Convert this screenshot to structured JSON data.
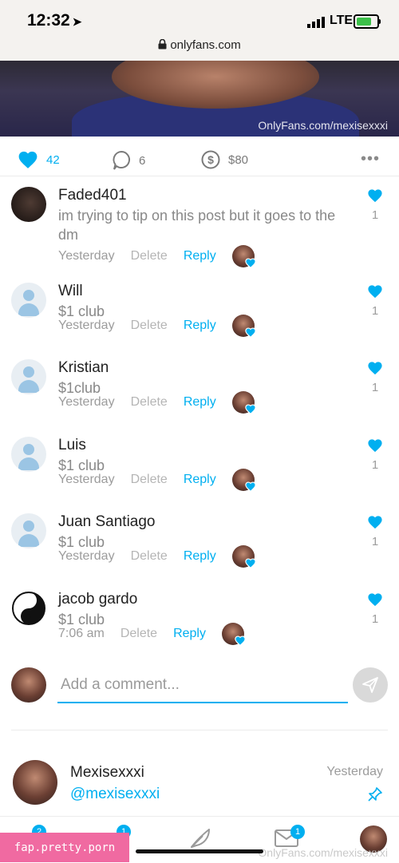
{
  "status_bar": {
    "time": "12:32",
    "network": "LTE",
    "url": "onlyfans.com"
  },
  "post": {
    "watermark": "OnlyFans.com/mexisexxxi",
    "likes": "42",
    "comments": "6",
    "tips": "$80"
  },
  "comments": [
    {
      "author": "Faded401",
      "text": "im trying to tip on this post but it goes to the dm",
      "time": "Yesterday",
      "delete_label": "Delete",
      "reply_label": "Reply",
      "likes": "1"
    },
    {
      "author": "Will",
      "text": "$1 club",
      "time": "Yesterday",
      "delete_label": "Delete",
      "reply_label": "Reply",
      "likes": "1"
    },
    {
      "author": "Kristian",
      "text": "$1club",
      "time": "Yesterday",
      "delete_label": "Delete",
      "reply_label": "Reply",
      "likes": "1"
    },
    {
      "author": "Luis",
      "text": "$1 club",
      "time": "Yesterday",
      "delete_label": "Delete",
      "reply_label": "Reply",
      "likes": "1"
    },
    {
      "author": "Juan Santiago",
      "text": "$1 club",
      "time": "Yesterday",
      "delete_label": "Delete",
      "reply_label": "Reply",
      "likes": "1"
    },
    {
      "author": "jacob gardo",
      "text": "$1 club",
      "time": "7:06 am",
      "delete_label": "Delete",
      "reply_label": "Reply",
      "likes": "1"
    }
  ],
  "add_comment": {
    "placeholder": "Add a comment..."
  },
  "creator": {
    "name": "Mexisexxxi",
    "handle": "@mexisexxxi",
    "time": "Yesterday"
  },
  "bottom_nav": {
    "messages_badge": "1",
    "home_badge": "2",
    "notif_badge": "1"
  },
  "footer": {
    "watermark": "OnlyFans.com/mexisexxxi",
    "site_tag": "fap.pretty.porn"
  },
  "colors": {
    "accent": "#00aff0",
    "muted": "#9c9c9c"
  }
}
